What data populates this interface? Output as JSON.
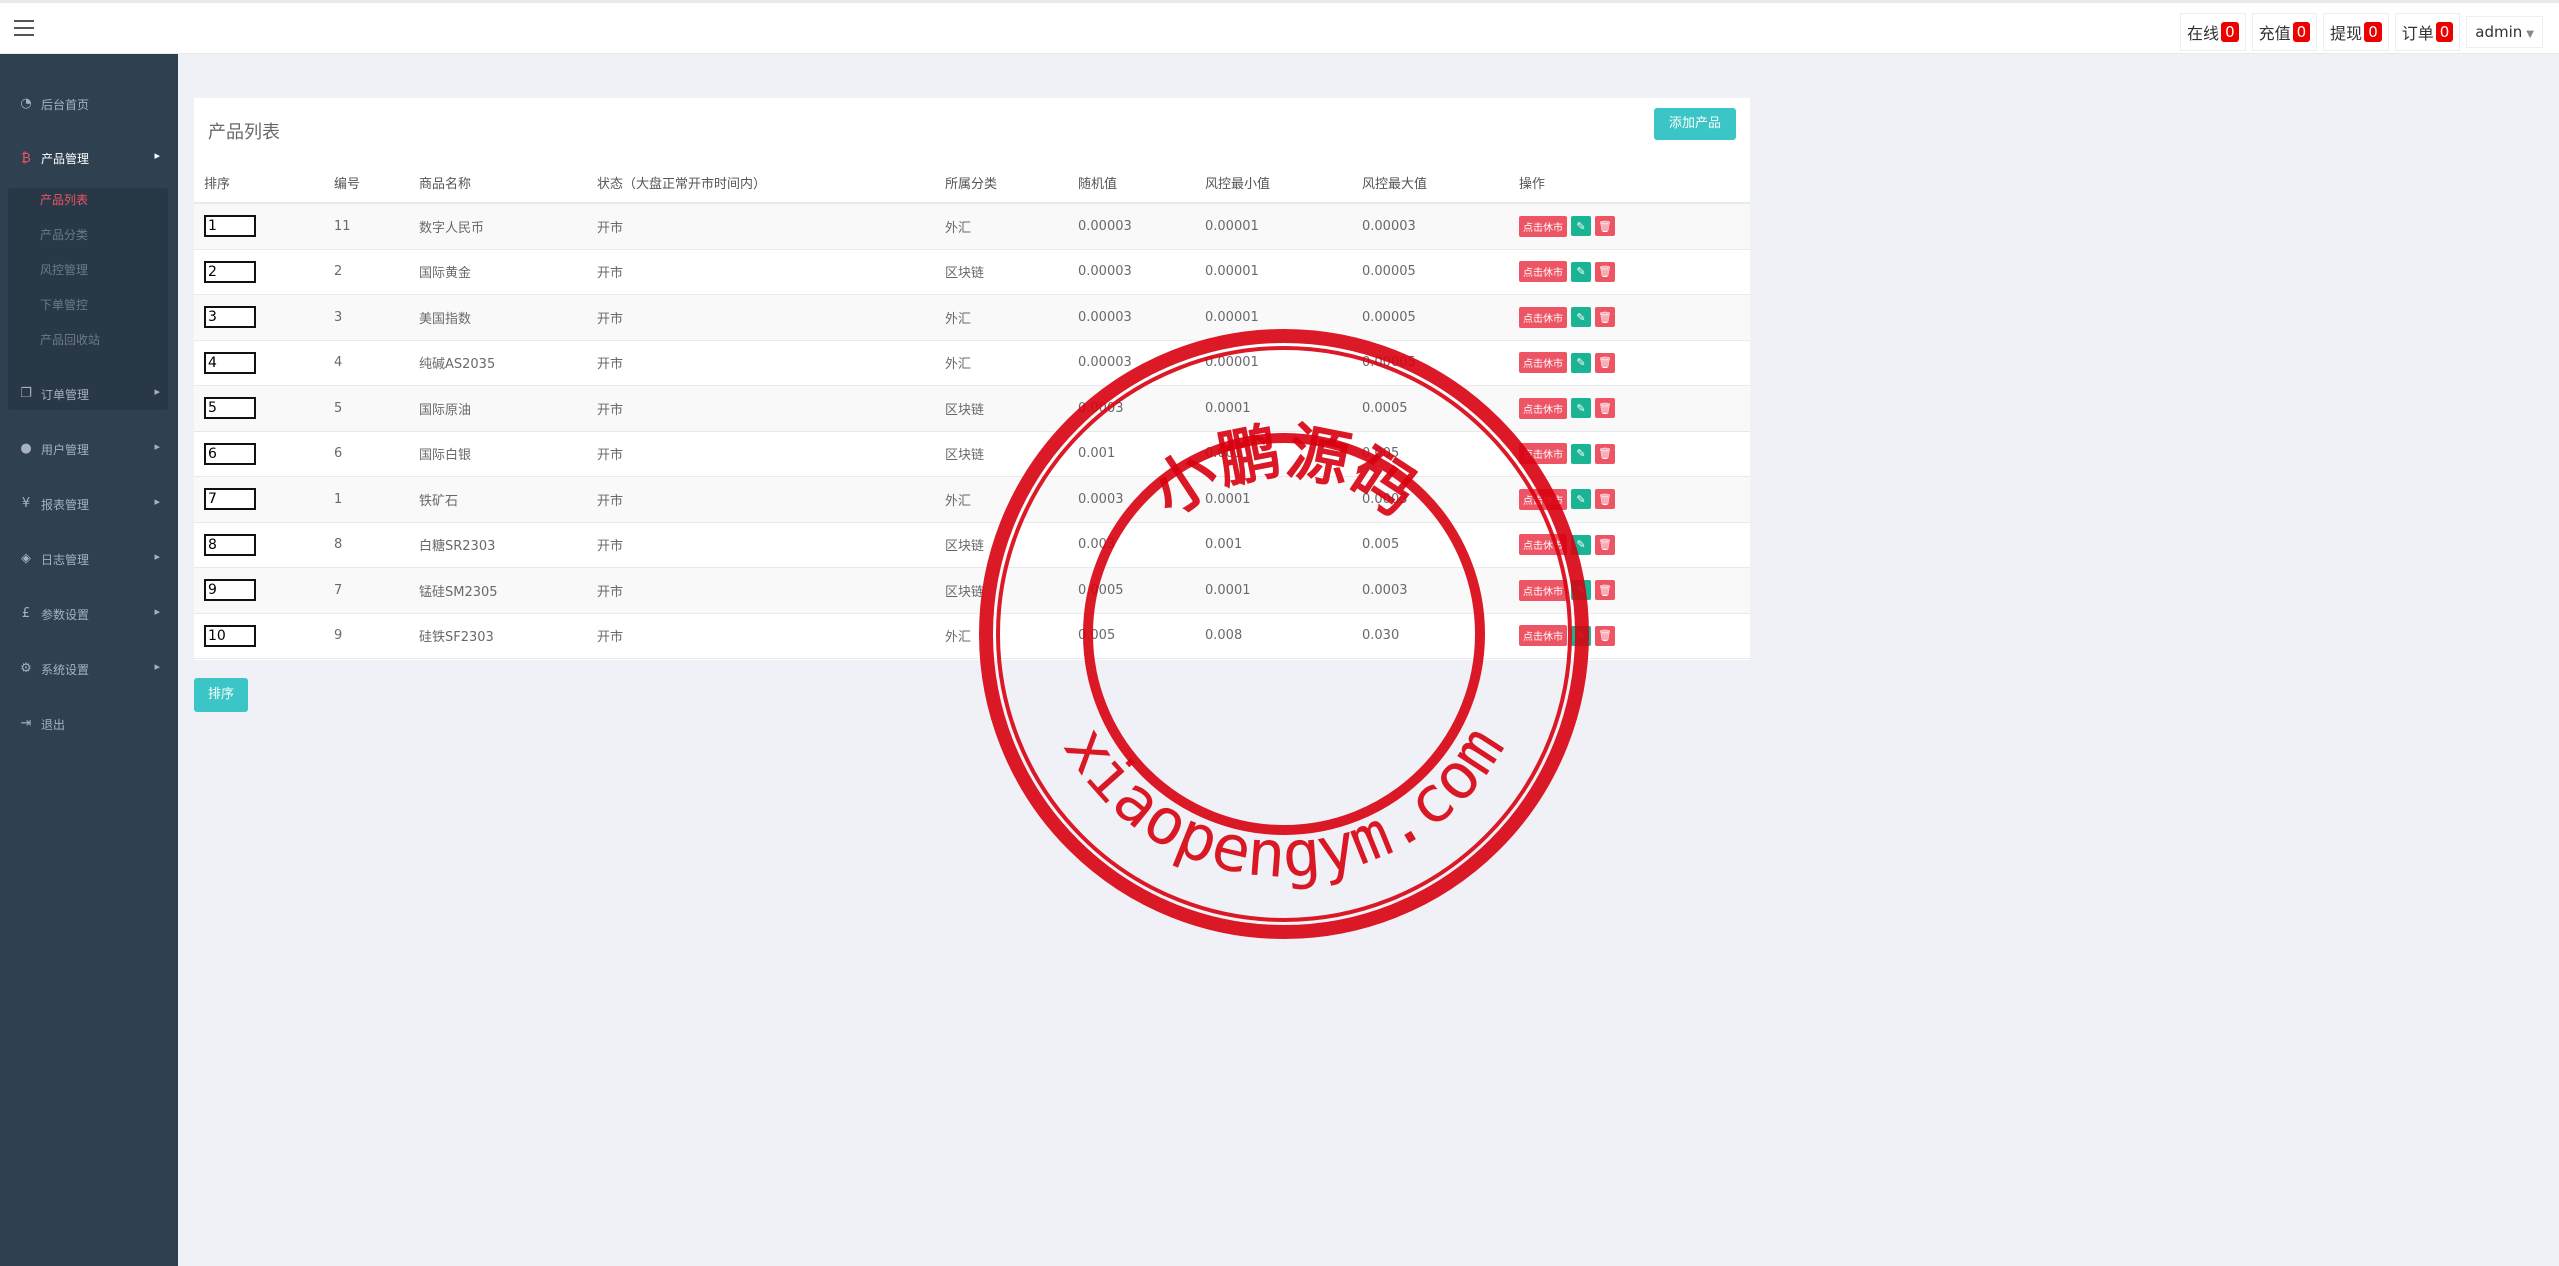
{
  "topbar": {
    "stats": [
      {
        "label": "在线",
        "count": "0"
      },
      {
        "label": "充值",
        "count": "0"
      },
      {
        "label": "提现",
        "count": "0"
      },
      {
        "label": "订单",
        "count": "0"
      }
    ],
    "user": "admin"
  },
  "sidebar": {
    "items": [
      {
        "label": "后台首页",
        "icon": "dashboard-icon"
      },
      {
        "label": "产品管理",
        "icon": "bitcoin-icon"
      },
      {
        "label": "订单管理",
        "icon": "copy-icon"
      },
      {
        "label": "用户管理",
        "icon": "user-icon"
      },
      {
        "label": "报表管理",
        "icon": "yen-icon"
      },
      {
        "label": "日志管理",
        "icon": "tags-icon"
      },
      {
        "label": "参数设置",
        "icon": "pound-icon"
      },
      {
        "label": "系统设置",
        "icon": "gears-icon"
      },
      {
        "label": "退出",
        "icon": "sign-out-icon"
      }
    ],
    "sub_items": [
      "产品列表",
      "产品分类",
      "风控管理",
      "下单管控",
      "产品回收站"
    ]
  },
  "main": {
    "title": "产品列表",
    "add_button": "添加产品",
    "sort_button": "排序",
    "columns": [
      "排序",
      "编号",
      "商品名称",
      "状态（大盘正常开市时间内）",
      "所属分类",
      "随机值",
      "风控最小值",
      "风控最大值",
      "操作"
    ],
    "close_label": "点击休市",
    "rows": [
      {
        "sort": "1",
        "id": "11",
        "name": "数字人民币",
        "status": "开市",
        "category": "外汇",
        "random": "0.00003",
        "min": "0.00001",
        "max": "0.00003"
      },
      {
        "sort": "2",
        "id": "2",
        "name": "国际黄金",
        "status": "开市",
        "category": "区块链",
        "random": "0.00003",
        "min": "0.00001",
        "max": "0.00005"
      },
      {
        "sort": "3",
        "id": "3",
        "name": "美国指数",
        "status": "开市",
        "category": "外汇",
        "random": "0.00003",
        "min": "0.00001",
        "max": "0.00005"
      },
      {
        "sort": "4",
        "id": "4",
        "name": "纯碱AS2035",
        "status": "开市",
        "category": "外汇",
        "random": "0.00003",
        "min": "0.00001",
        "max": "0.00005"
      },
      {
        "sort": "5",
        "id": "5",
        "name": "国际原油",
        "status": "开市",
        "category": "区块链",
        "random": "0.0003",
        "min": "0.0001",
        "max": "0.0005"
      },
      {
        "sort": "6",
        "id": "6",
        "name": "国际白银",
        "status": "开市",
        "category": "区块链",
        "random": "0.001",
        "min": "0.001",
        "max": "0.005"
      },
      {
        "sort": "7",
        "id": "1",
        "name": "铁矿石",
        "status": "开市",
        "category": "外汇",
        "random": "0.0003",
        "min": "0.0001",
        "max": "0.0003"
      },
      {
        "sort": "8",
        "id": "8",
        "name": "白糖SR2303",
        "status": "开市",
        "category": "区块链",
        "random": "0.003",
        "min": "0.001",
        "max": "0.005"
      },
      {
        "sort": "9",
        "id": "7",
        "name": "锰硅SM2305",
        "status": "开市",
        "category": "区块链",
        "random": "0.0005",
        "min": "0.0001",
        "max": "0.0003"
      },
      {
        "sort": "10",
        "id": "9",
        "name": "硅铁SF2303",
        "status": "开市",
        "category": "外汇",
        "random": "0.005",
        "min": "0.008",
        "max": "0.030"
      }
    ]
  },
  "stamp": {
    "top_text": "小鹏源码",
    "bottom_text": "xiaopengym.com",
    "color": "#d8000f"
  }
}
